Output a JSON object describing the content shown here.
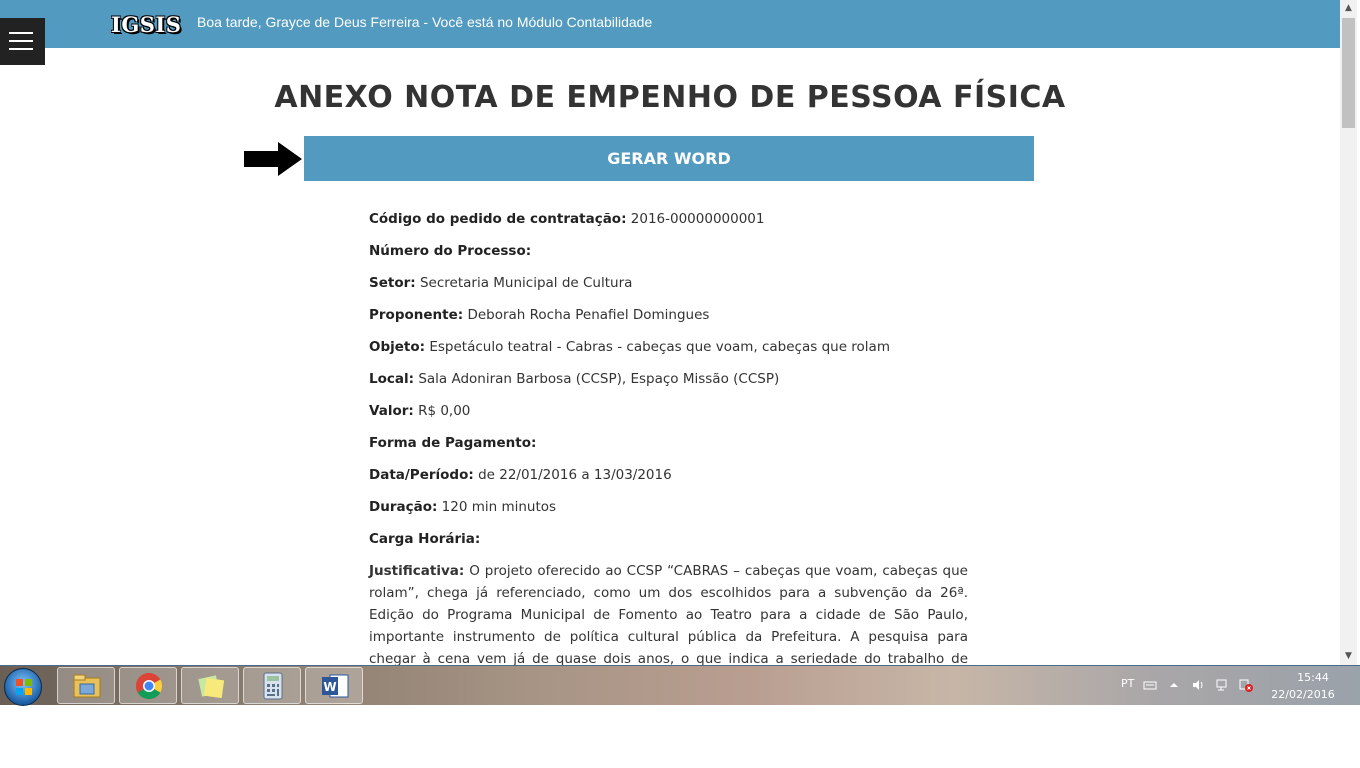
{
  "header": {
    "logo": "IGSIS",
    "greeting": "Boa tarde, Grayce de Deus Ferreira - Você está no Módulo Contabilidade",
    "bg_color": "#529ac0"
  },
  "page": {
    "title": "ANEXO NOTA DE EMPENHO DE PESSOA FÍSICA",
    "generate_button": "GERAR WORD"
  },
  "fields": [
    {
      "label": "Código do pedido de contratação:",
      "value": "2016-00000000001"
    },
    {
      "label": "Número do Processo:",
      "value": ""
    },
    {
      "label": "Setor:",
      "value": "Secretaria Municipal de Cultura"
    },
    {
      "label": "Proponente:",
      "value": "Deborah Rocha Penafiel Domingues"
    },
    {
      "label": "Objeto:",
      "value": "Espetáculo teatral - Cabras - cabeças que voam, cabeças que rolam"
    },
    {
      "label": "Local:",
      "value": "Sala Adoniran Barbosa (CCSP), Espaço Missão (CCSP)"
    },
    {
      "label": "Valor:",
      "value": "R$ 0,00"
    },
    {
      "label": "Forma de Pagamento:",
      "value": ""
    },
    {
      "label": "Data/Período:",
      "value": "de 22/01/2016 a 13/03/2016"
    },
    {
      "label": "Duração:",
      "value": "120 min minutos"
    },
    {
      "label": "Carga Horária:",
      "value": ""
    }
  ],
  "justificativa": {
    "label": "Justificativa:",
    "text": "O projeto oferecido ao CCSP “CABRAS – cabeças que voam, cabeças que rolam”, chega já referenciado, como um dos escolhidos para a subvenção da 26ª. Edição do Programa Municipal de Fomento ao Teatro para a cidade de São Paulo, importante instrumento de política cultural pública da Prefeitura. A pesquisa para chegar à cena vem já de quase dois anos, o que indica a seriedade do trabalho de prospecção estética que é"
  },
  "taskbar": {
    "apps": [
      "windows-explorer",
      "google-chrome",
      "sticky-notes",
      "calculator",
      "microsoft-word"
    ],
    "language": "PT",
    "time": "15:44",
    "date": "22/02/2016"
  }
}
